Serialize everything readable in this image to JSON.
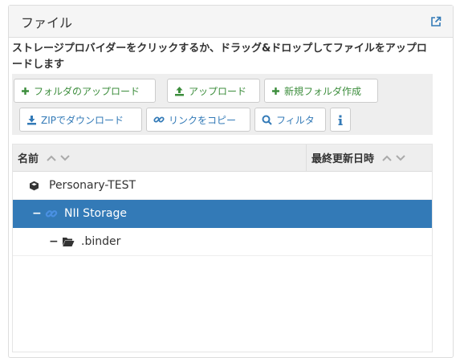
{
  "panel": {
    "title": "ファイル",
    "open_icon": "external-link-icon"
  },
  "instruction": "ストレージプロバイダーをクリックするか、ドラッグ&ドロップしてファイルをアップロードします",
  "toolbar": {
    "upload_folder": "フォルダのアップロード",
    "upload": "アップロード",
    "new_folder": "新規フォルダ作成",
    "zip_download": "ZIPでダウンロード",
    "copy_link": "リンクをコピー",
    "filter": "フィルタ",
    "info_icon": "info-icon"
  },
  "grid": {
    "col_name": "名前",
    "col_modified": "最終更新日時",
    "rows": [
      {
        "name": "Personary-TEST",
        "icon": "cube-icon",
        "selected": false,
        "toggle": ""
      },
      {
        "name": "NII Storage",
        "icon": "chain-link-icon",
        "selected": true,
        "toggle": "−"
      },
      {
        "name": ".binder",
        "icon": "folder-open-icon",
        "selected": false,
        "toggle": "−"
      }
    ]
  },
  "colors": {
    "accent": "#337ab7",
    "success": "#3c8d3c",
    "header_bg": "#f5f5f5",
    "toolbar_bg": "#eeeeee"
  }
}
